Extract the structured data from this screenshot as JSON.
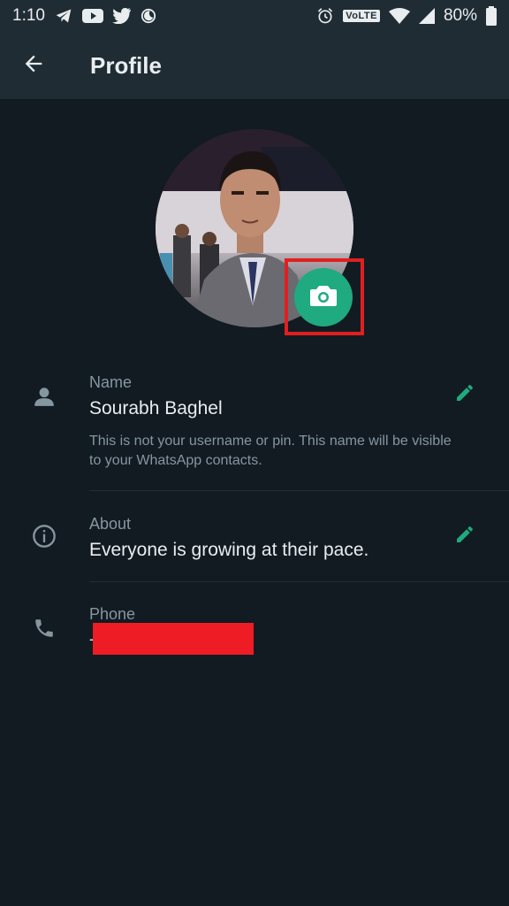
{
  "status_bar": {
    "time": "1:10",
    "battery": "80%",
    "volte": "VoLTE",
    "left_icons": [
      "telegram-icon",
      "youtube-icon",
      "twitter-icon",
      "moon-icon"
    ],
    "right_icons": [
      "alarm-icon",
      "volte-icon",
      "wifi-icon",
      "signal-icon",
      "battery-icon"
    ]
  },
  "app_bar": {
    "title": "Profile"
  },
  "name_row": {
    "label": "Name",
    "value": "Sourabh Baghel",
    "hint": "This is not your username or pin. This name will be visible to your WhatsApp contacts."
  },
  "about_row": {
    "label": "About",
    "value": "Everyone is growing at their pace."
  },
  "phone_row": {
    "label": "Phone",
    "value": "-"
  },
  "colors": {
    "background": "#121b22",
    "app_bar": "#1f2c34",
    "accent": "#1faa7f",
    "highlight": "#e02020",
    "redaction": "#ee1c25"
  }
}
